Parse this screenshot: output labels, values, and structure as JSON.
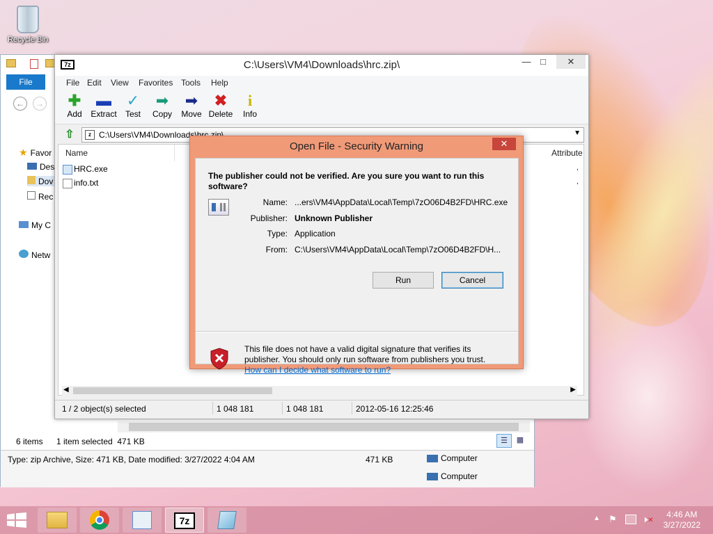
{
  "desktop": {
    "recycle_bin_label": "Recycle Bin"
  },
  "explorer": {
    "ribbon_file": "File",
    "nav": [
      "Favor",
      "Des",
      "Dov",
      "Rec",
      "My C",
      "Netw"
    ],
    "status_items": "6 items",
    "status_selected": "1 item selected  471 KB",
    "details_text": "Type: zip Archive, Size: 471 KB, Date modified: 3/27/2022 4:04 AM",
    "details_size": "471 KB",
    "details_location_1": "Computer",
    "details_location_2": "Computer"
  },
  "sevenzip": {
    "title": "C:\\Users\\VM4\\Downloads\\hrc.zip\\",
    "menu": [
      "File",
      "Edit",
      "View",
      "Favorites",
      "Tools",
      "Help"
    ],
    "toolbar": [
      "Add",
      "Extract",
      "Test",
      "Copy",
      "Move",
      "Delete",
      "Info"
    ],
    "address": "C:\\Users\\VM4\\Downloads\\hrc.zip\\",
    "columns": {
      "name": "Name",
      "attributes": "Attribute"
    },
    "files": [
      {
        "name": "HRC.exe"
      },
      {
        "name": "info.txt"
      }
    ],
    "status": [
      "1 / 2 object(s) selected",
      "1 048 181",
      "1 048 181",
      "2012-05-16 12:25:46"
    ]
  },
  "dialog": {
    "title": "Open File - Security Warning",
    "question": "The publisher could not be verified.  Are you sure you want to run this software?",
    "labels": {
      "name": "Name:",
      "publisher": "Publisher:",
      "type": "Type:",
      "from": "From:"
    },
    "values": {
      "name": "...ers\\VM4\\AppData\\Local\\Temp\\7zO06D4B2FD\\HRC.exe",
      "publisher": "Unknown Publisher",
      "type": "Application",
      "from": "C:\\Users\\VM4\\AppData\\Local\\Temp\\7zO06D4B2FD\\H..."
    },
    "run_label": "Run",
    "cancel_label": "Cancel",
    "warning": "This file does not have a valid digital signature that verifies its publisher.  You should only run software from publishers you trust.",
    "link": "How can I decide what software to run?"
  },
  "taskbar": {
    "time": "4:46 AM",
    "date": "3/27/2022",
    "app_7z_label": "7z"
  }
}
